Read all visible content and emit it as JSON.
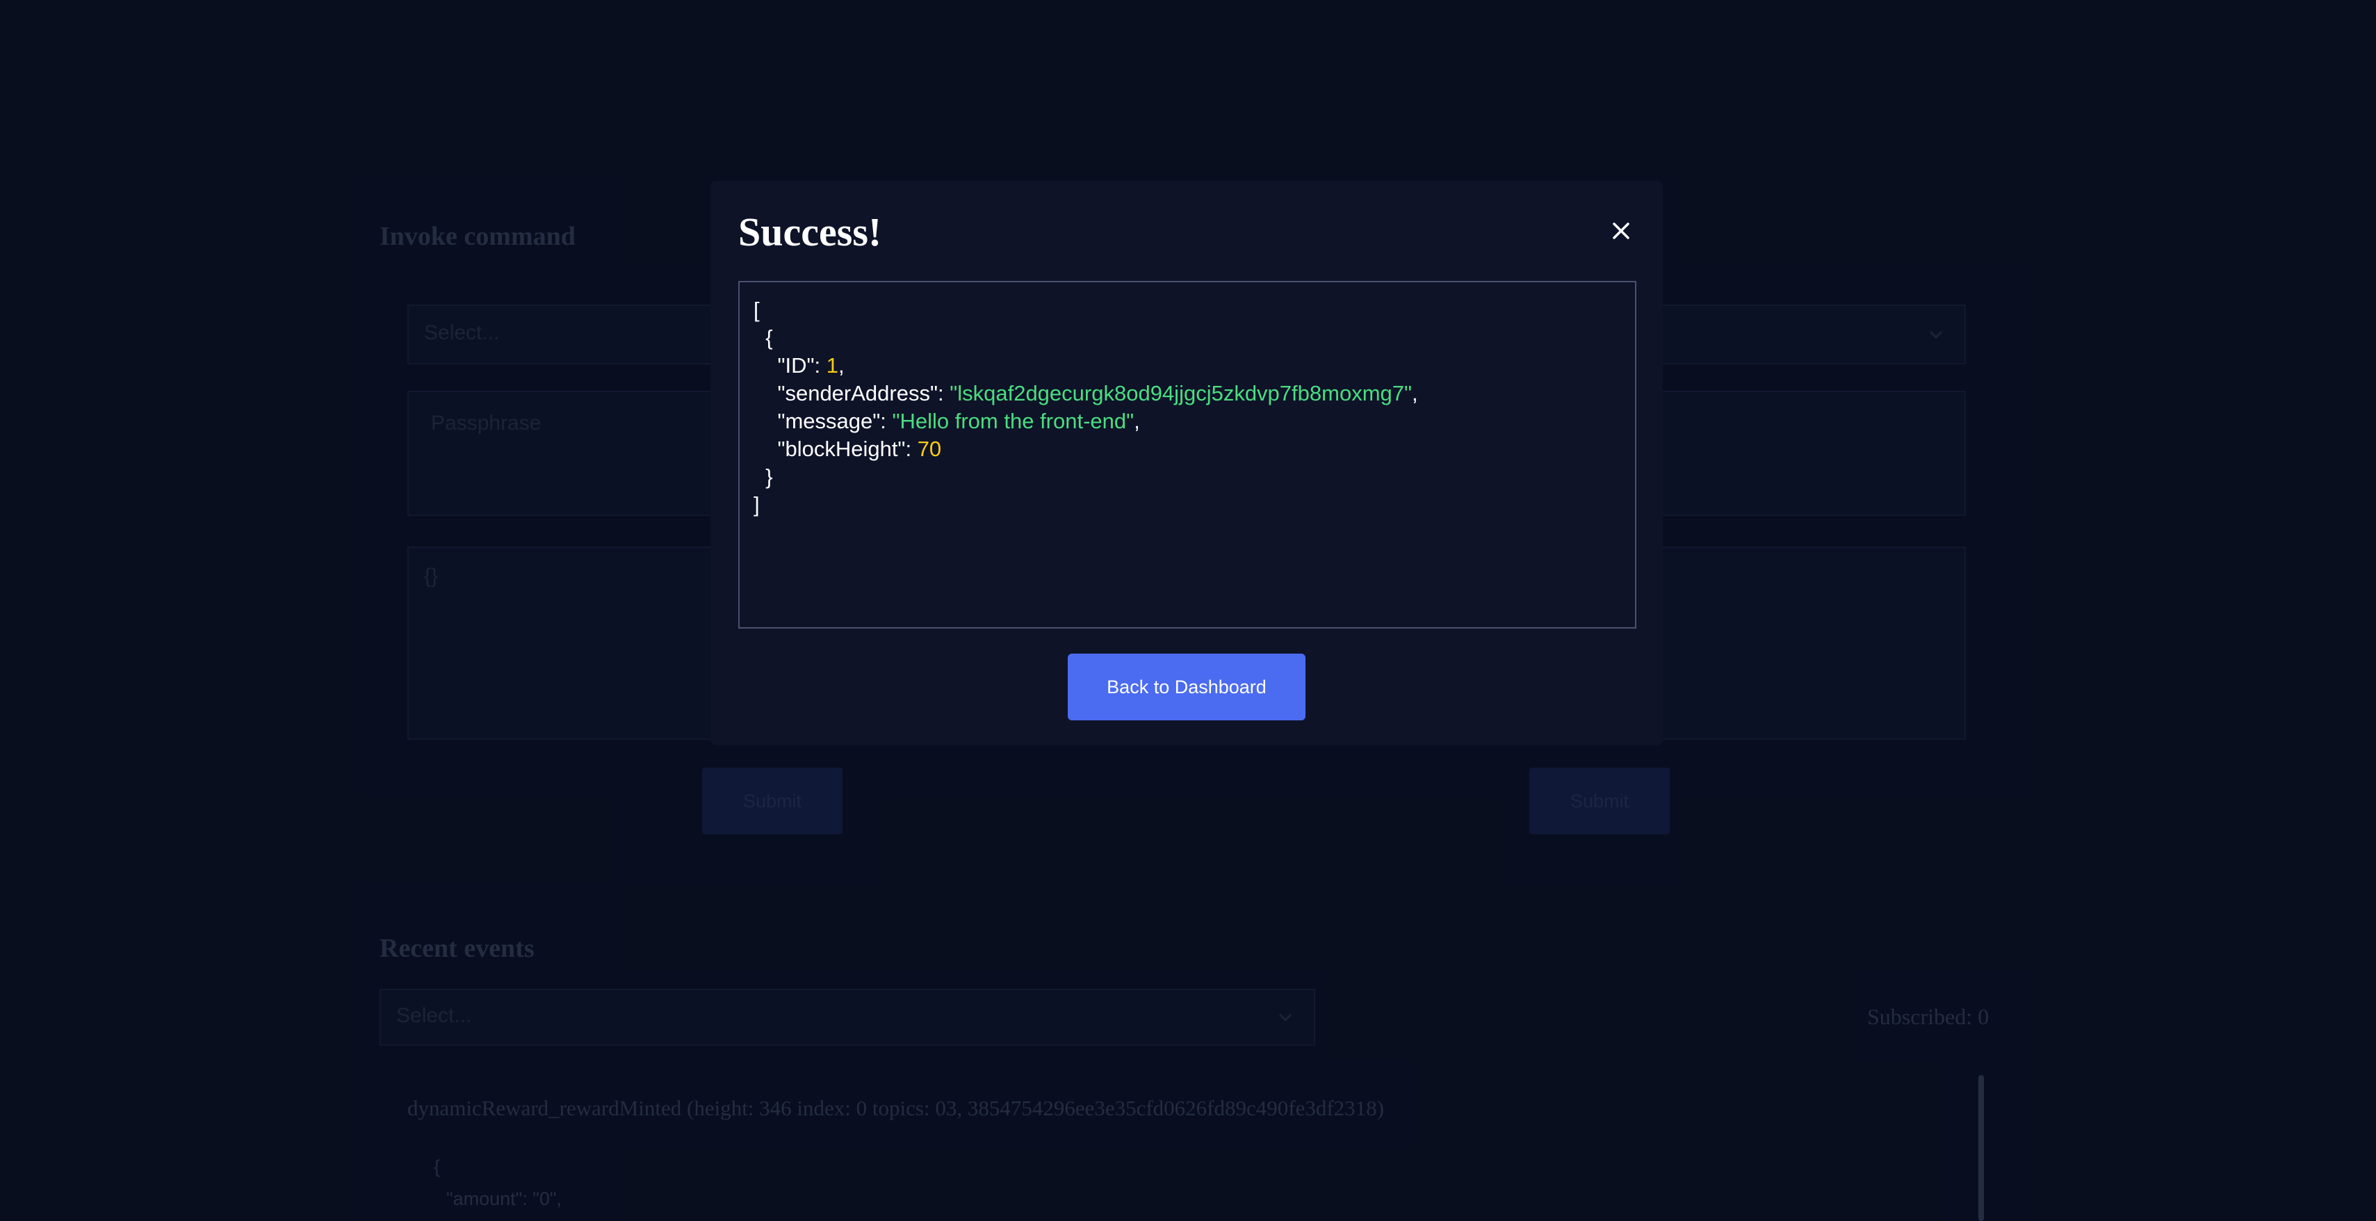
{
  "invoke": {
    "heading": "Invoke command",
    "select_placeholder": "Select...",
    "passphrase_placeholder": "Passphrase",
    "params_value": "{}",
    "submit_left": "Submit",
    "submit_right": "Submit"
  },
  "events": {
    "heading": "Recent events",
    "select_placeholder": "Select...",
    "subscribed": "Subscribed: 0",
    "item_title": "dynamicReward_rewardMinted (height: 346 index: 0 topics: 03, 3854754296ee3e35cfd0626fd89c490fe3df2318)",
    "item_json_open": "{",
    "item_json_key": "\"amount\"",
    "item_json_sep": ": ",
    "item_json_val": "\"0\"",
    "item_json_comma": ","
  },
  "modal": {
    "title": "Success!",
    "close_icon": "close-icon",
    "json": {
      "open_bracket": "[",
      "open_brace": "{",
      "id_key": "\"ID\"",
      "id_val": "1",
      "sender_key": "\"senderAddress\"",
      "sender_val": "\"lskqaf2dgecurgk8od94jjgcj5zkdvp7fb8moxmg7\"",
      "message_key": "\"message\"",
      "message_val": "\"Hello from the front-end\"",
      "height_key": "\"blockHeight\"",
      "height_val": "70",
      "close_brace": "}",
      "close_bracket": "]",
      "colon": ": ",
      "comma": ","
    },
    "button_label": "Back to Dashboard"
  },
  "colors": {
    "background": "#0c1226",
    "modal": "#0e1328",
    "accent": "#4b6cf0",
    "json_string": "#4ade80",
    "json_number": "#facc15"
  }
}
